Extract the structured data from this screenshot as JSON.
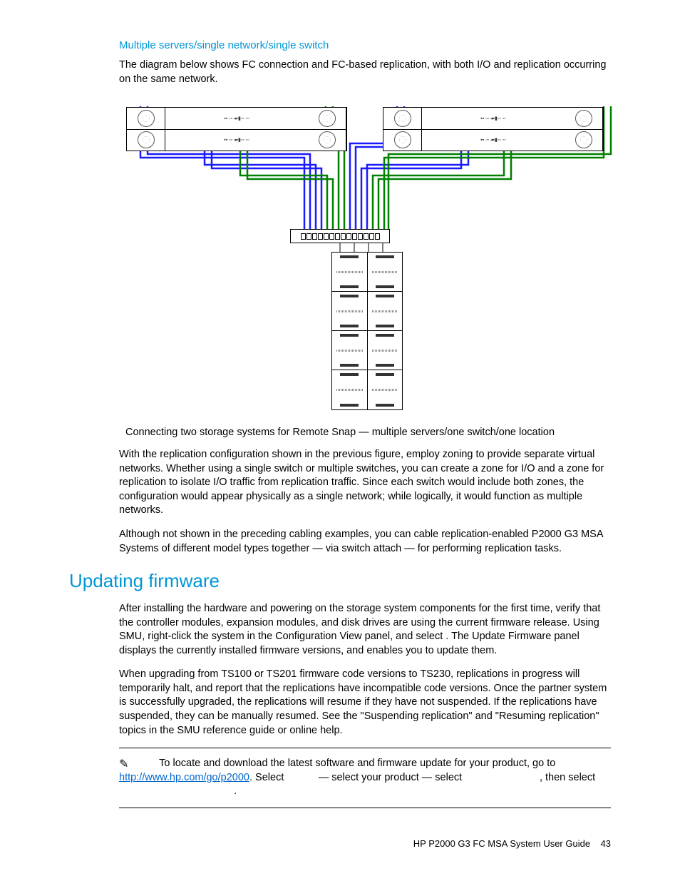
{
  "section": {
    "subheading": "Multiple servers/single network/single switch",
    "intro": "The diagram below shows FC connection and FC-based replication, with both I/O and replication occurring on the same network.",
    "caption": "Connecting two storage systems for Remote Snap — multiple servers/one switch/one location",
    "para1": "With the replication configuration shown in the previous figure, employ zoning to provide separate virtual networks. Whether using a single switch or multiple switches, you can create a zone for I/O and a zone for replication to isolate I/O traffic from replication traffic. Since each switch would include both zones, the configuration would appear physically as a single network; while logically, it would function as multiple networks.",
    "para2": "Although not shown in the preceding cabling examples, you can cable replication-enabled P2000 G3 MSA Systems of different model types together — via switch attach — for performing replication tasks."
  },
  "updating": {
    "heading": "Updating firmware",
    "para1": "After installing the hardware and powering on the storage system components for the first time, verify that the controller modules, expansion modules, and disk drives are using the current firmware release. Using SMU, right-click the system in the Configuration View panel, and select                                           . The Update Firmware panel displays the currently installed firmware versions, and enables you to update them.",
    "para2": "When upgrading from TS100 or TS201 firmware code versions to TS230, replications in progress will temporarily halt, and report that the replications have incompatible code versions. Once the partner system is successfully upgraded, the replications will resume if they have not suspended. If the replications have suspended, they can be manually resumed. See the \"Suspending replication\" and \"Resuming replication\" topics in the SMU reference guide or online help."
  },
  "note": {
    "lead": "To locate and download the latest software and firmware update for your product, go to ",
    "url": "http://www.hp.com/go/p2000",
    "mid1": ". Select ",
    "mid2": " — select your product — select ",
    "mid3": ", then select ",
    "end": "."
  },
  "footer": {
    "title": "HP P2000 G3 FC MSA System User Guide",
    "page": "43"
  }
}
